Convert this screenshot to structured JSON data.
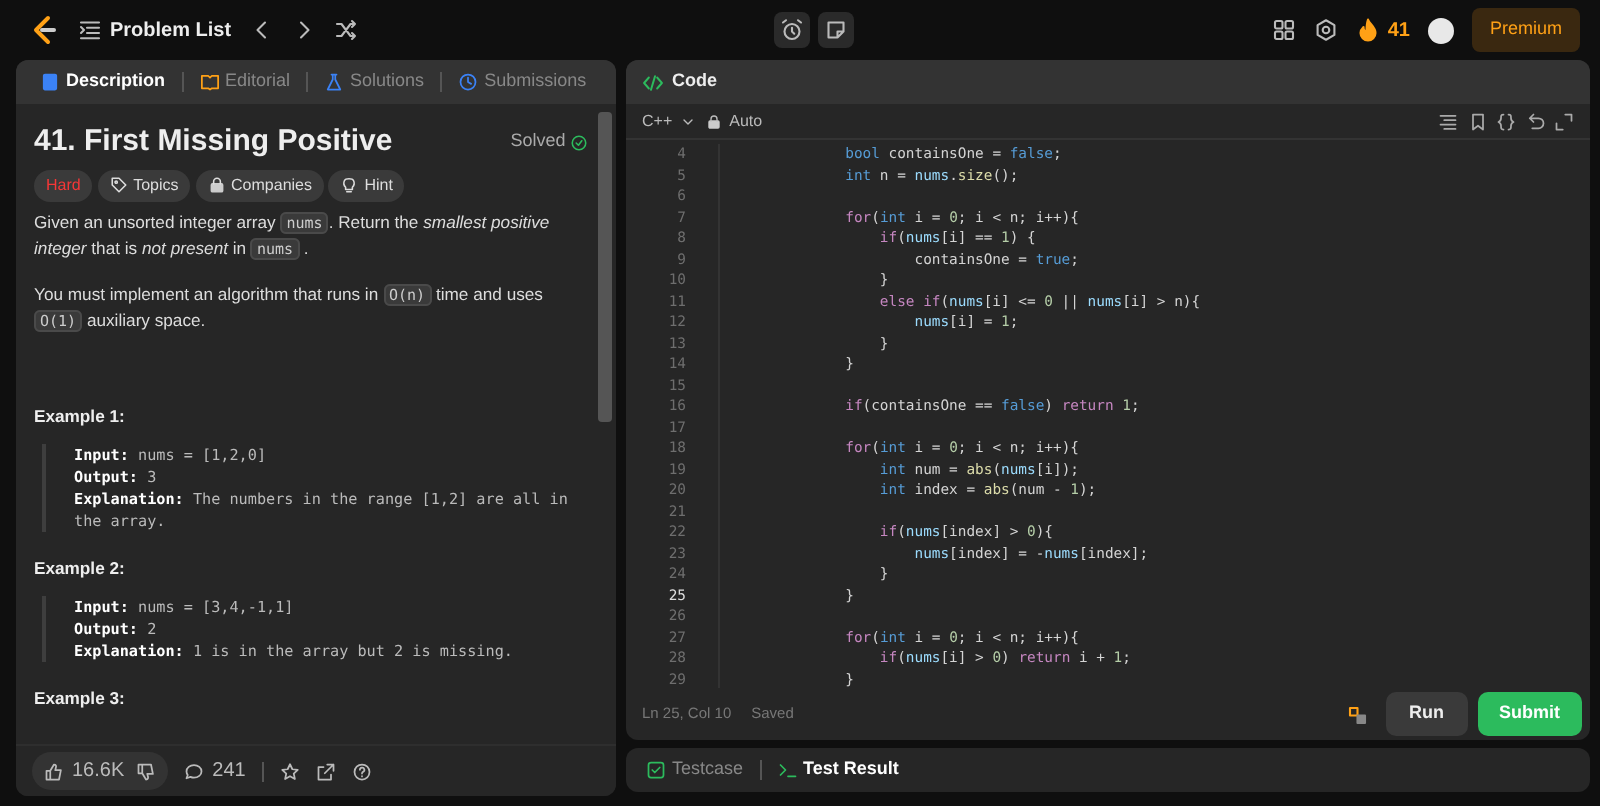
{
  "top_bar": {
    "problem_list": "Problem List",
    "streak": "41",
    "premium": "Premium"
  },
  "description_panel": {
    "tabs": [
      {
        "label": "Description",
        "selected": true
      },
      {
        "label": "Editorial",
        "selected": false
      },
      {
        "label": "Solutions",
        "selected": false
      },
      {
        "label": "Submissions",
        "selected": false
      }
    ],
    "title": "41. First Missing Positive",
    "status": "Solved",
    "tags": [
      {
        "label": "Hard",
        "kind": "difficulty"
      },
      {
        "label": "Topics",
        "kind": "topics"
      },
      {
        "label": "Companies",
        "kind": "companies"
      },
      {
        "label": "Hint",
        "kind": "hint"
      }
    ],
    "paragraphs": [
      [
        {
          "text": "Given an unsorted integer array ",
          "kind": "prose"
        },
        {
          "text": "nums",
          "kind": "code"
        },
        {
          "text": ". Return the *smallest positive integer* that is *not present* in ",
          "kind": "prose"
        },
        {
          "text": "nums",
          "kind": "code"
        },
        {
          "text": " .",
          "kind": "prose"
        }
      ],
      [
        {
          "text": "You must implement an algorithm that runs in ",
          "kind": "prose"
        },
        {
          "text": "O(n)",
          "kind": "code"
        },
        {
          "text": " time and uses ",
          "kind": "prose"
        },
        {
          "text": "O(1)",
          "kind": "code"
        },
        {
          "text": " auxiliary space.",
          "kind": "prose"
        }
      ]
    ],
    "examples": [
      {
        "heading": "Example 1:",
        "lines": [
          "**Input:** nums = [1,2,0]",
          "**Output:** 3",
          "**Explanation:** The numbers in the range [1,2] are all in the array."
        ]
      },
      {
        "heading": "Example 2:",
        "lines": [
          "**Input:** nums = [3,4,-1,1]",
          "**Output:** 2",
          "**Explanation:** 1 is in the array but 2 is missing."
        ]
      },
      {
        "heading": "Example 3:"
      }
    ],
    "likes": "16.6K",
    "comments": "241"
  },
  "code_panel": {
    "title": "Code",
    "language": "C++",
    "mode": "Auto",
    "lines": [
      {
        "number": "4",
        "active": false,
        "parts": [
          {
            "text": "        bool",
            "kind": "type"
          },
          {
            "text": " containsOne = ",
            "kind": "plain"
          },
          {
            "text": "false",
            "kind": "type"
          },
          {
            "text": ";",
            "kind": "plain"
          }
        ]
      },
      {
        "number": "5",
        "active": false,
        "parts": [
          {
            "text": "        int",
            "kind": "type"
          },
          {
            "text": " n = ",
            "kind": "plain"
          },
          {
            "text": "nums",
            "kind": "variable"
          },
          {
            "text": ".",
            "kind": "plain"
          },
          {
            "text": "size",
            "kind": "function"
          },
          {
            "text": "();",
            "kind": "plain"
          }
        ]
      },
      {
        "number": "6",
        "active": false
      },
      {
        "number": "7",
        "active": false,
        "parts": [
          {
            "text": "        for",
            "kind": "keyword"
          },
          {
            "text": "(",
            "kind": "plain"
          },
          {
            "text": "int",
            "kind": "type"
          },
          {
            "text": " i = ",
            "kind": "plain"
          },
          {
            "text": "0",
            "kind": "number"
          },
          {
            "text": "; i < n; i++){",
            "kind": "plain"
          }
        ]
      },
      {
        "number": "8",
        "active": false,
        "parts": [
          {
            "text": "            if",
            "kind": "keyword"
          },
          {
            "text": "(",
            "kind": "plain"
          },
          {
            "text": "nums",
            "kind": "variable"
          },
          {
            "text": "[i] == ",
            "kind": "plain"
          },
          {
            "text": "1",
            "kind": "number"
          },
          {
            "text": ") {",
            "kind": "plain"
          }
        ]
      },
      {
        "number": "9",
        "active": false,
        "parts": [
          {
            "text": "                containsOne = ",
            "kind": "plain"
          },
          {
            "text": "true",
            "kind": "type"
          },
          {
            "text": ";",
            "kind": "plain"
          }
        ]
      },
      {
        "number": "10",
        "active": false,
        "parts": [
          {
            "text": "            }",
            "kind": "plain"
          }
        ]
      },
      {
        "number": "11",
        "active": false,
        "parts": [
          {
            "text": "            else if",
            "kind": "keyword"
          },
          {
            "text": "(",
            "kind": "plain"
          },
          {
            "text": "nums",
            "kind": "variable"
          },
          {
            "text": "[i] <= ",
            "kind": "plain"
          },
          {
            "text": "0",
            "kind": "number"
          },
          {
            "text": " || ",
            "kind": "plain"
          },
          {
            "text": "nums",
            "kind": "variable"
          },
          {
            "text": "[i] > n){",
            "kind": "plain"
          }
        ]
      },
      {
        "number": "12",
        "active": false,
        "parts": [
          {
            "text": "                nums",
            "kind": "variable"
          },
          {
            "text": "[i] = ",
            "kind": "plain"
          },
          {
            "text": "1",
            "kind": "number"
          },
          {
            "text": ";",
            "kind": "plain"
          }
        ]
      },
      {
        "number": "13",
        "active": false,
        "parts": [
          {
            "text": "            }",
            "kind": "plain"
          }
        ]
      },
      {
        "number": "14",
        "active": false,
        "parts": [
          {
            "text": "        }",
            "kind": "plain"
          }
        ]
      },
      {
        "number": "15",
        "active": false
      },
      {
        "number": "16",
        "active": false,
        "parts": [
          {
            "text": "        if",
            "kind": "keyword"
          },
          {
            "text": "(containsOne == ",
            "kind": "plain"
          },
          {
            "text": "false",
            "kind": "type"
          },
          {
            "text": ") ",
            "kind": "plain"
          },
          {
            "text": "return",
            "kind": "keyword"
          },
          {
            "text": " 1",
            "kind": "number"
          },
          {
            "text": ";",
            "kind": "plain"
          }
        ]
      },
      {
        "number": "17",
        "active": false
      },
      {
        "number": "18",
        "active": false,
        "parts": [
          {
            "text": "        for",
            "kind": "keyword"
          },
          {
            "text": "(",
            "kind": "plain"
          },
          {
            "text": "int",
            "kind": "type"
          },
          {
            "text": " i = ",
            "kind": "plain"
          },
          {
            "text": "0",
            "kind": "number"
          },
          {
            "text": "; i < n; i++){",
            "kind": "plain"
          }
        ]
      },
      {
        "number": "19",
        "active": false,
        "parts": [
          {
            "text": "            int",
            "kind": "type"
          },
          {
            "text": " num = ",
            "kind": "plain"
          },
          {
            "text": "abs",
            "kind": "function"
          },
          {
            "text": "(",
            "kind": "plain"
          },
          {
            "text": "nums",
            "kind": "variable"
          },
          {
            "text": "[i]);",
            "kind": "plain"
          }
        ]
      },
      {
        "number": "20",
        "active": false,
        "parts": [
          {
            "text": "            int",
            "kind": "type"
          },
          {
            "text": " index = ",
            "kind": "plain"
          },
          {
            "text": "abs",
            "kind": "function"
          },
          {
            "text": "(num - ",
            "kind": "plain"
          },
          {
            "text": "1",
            "kind": "number"
          },
          {
            "text": ");",
            "kind": "plain"
          }
        ]
      },
      {
        "number": "21",
        "active": false
      },
      {
        "number": "22",
        "active": false,
        "parts": [
          {
            "text": "            if",
            "kind": "keyword"
          },
          {
            "text": "(",
            "kind": "plain"
          },
          {
            "text": "nums",
            "kind": "variable"
          },
          {
            "text": "[index] > ",
            "kind": "plain"
          },
          {
            "text": "0",
            "kind": "number"
          },
          {
            "text": "){",
            "kind": "plain"
          }
        ]
      },
      {
        "number": "23",
        "active": false,
        "parts": [
          {
            "text": "                nums",
            "kind": "variable"
          },
          {
            "text": "[index] = -",
            "kind": "plain"
          },
          {
            "text": "nums",
            "kind": "variable"
          },
          {
            "text": "[index];",
            "kind": "plain"
          }
        ]
      },
      {
        "number": "24",
        "active": false,
        "parts": [
          {
            "text": "            }",
            "kind": "plain"
          }
        ]
      },
      {
        "number": "25",
        "active": true,
        "parts": [
          {
            "text": "        }",
            "kind": "plain"
          }
        ]
      },
      {
        "number": "26",
        "active": false
      },
      {
        "number": "27",
        "active": false,
        "parts": [
          {
            "text": "        for",
            "kind": "keyword"
          },
          {
            "text": "(",
            "kind": "plain"
          },
          {
            "text": "int",
            "kind": "type"
          },
          {
            "text": " i = ",
            "kind": "plain"
          },
          {
            "text": "0",
            "kind": "number"
          },
          {
            "text": "; i < n; i++){",
            "kind": "plain"
          }
        ]
      },
      {
        "number": "28",
        "active": false,
        "parts": [
          {
            "text": "            if",
            "kind": "keyword"
          },
          {
            "text": "(",
            "kind": "plain"
          },
          {
            "text": "nums",
            "kind": "variable"
          },
          {
            "text": "[i] > ",
            "kind": "plain"
          },
          {
            "text": "0",
            "kind": "number"
          },
          {
            "text": ") ",
            "kind": "plain"
          },
          {
            "text": "return",
            "kind": "keyword"
          },
          {
            "text": " i + ",
            "kind": "plain"
          },
          {
            "text": "1",
            "kind": "number"
          },
          {
            "text": ";",
            "kind": "plain"
          }
        ]
      },
      {
        "number": "29",
        "active": false,
        "parts": [
          {
            "text": "        }",
            "kind": "plain"
          }
        ]
      }
    ],
    "cursor": "Ln 25, Col 10",
    "save_state": "Saved",
    "run": "Run",
    "submit": "Submit"
  },
  "console_tabs": [
    {
      "label": "Testcase",
      "selected": false
    },
    {
      "label": "Test Result",
      "selected": true
    }
  ]
}
